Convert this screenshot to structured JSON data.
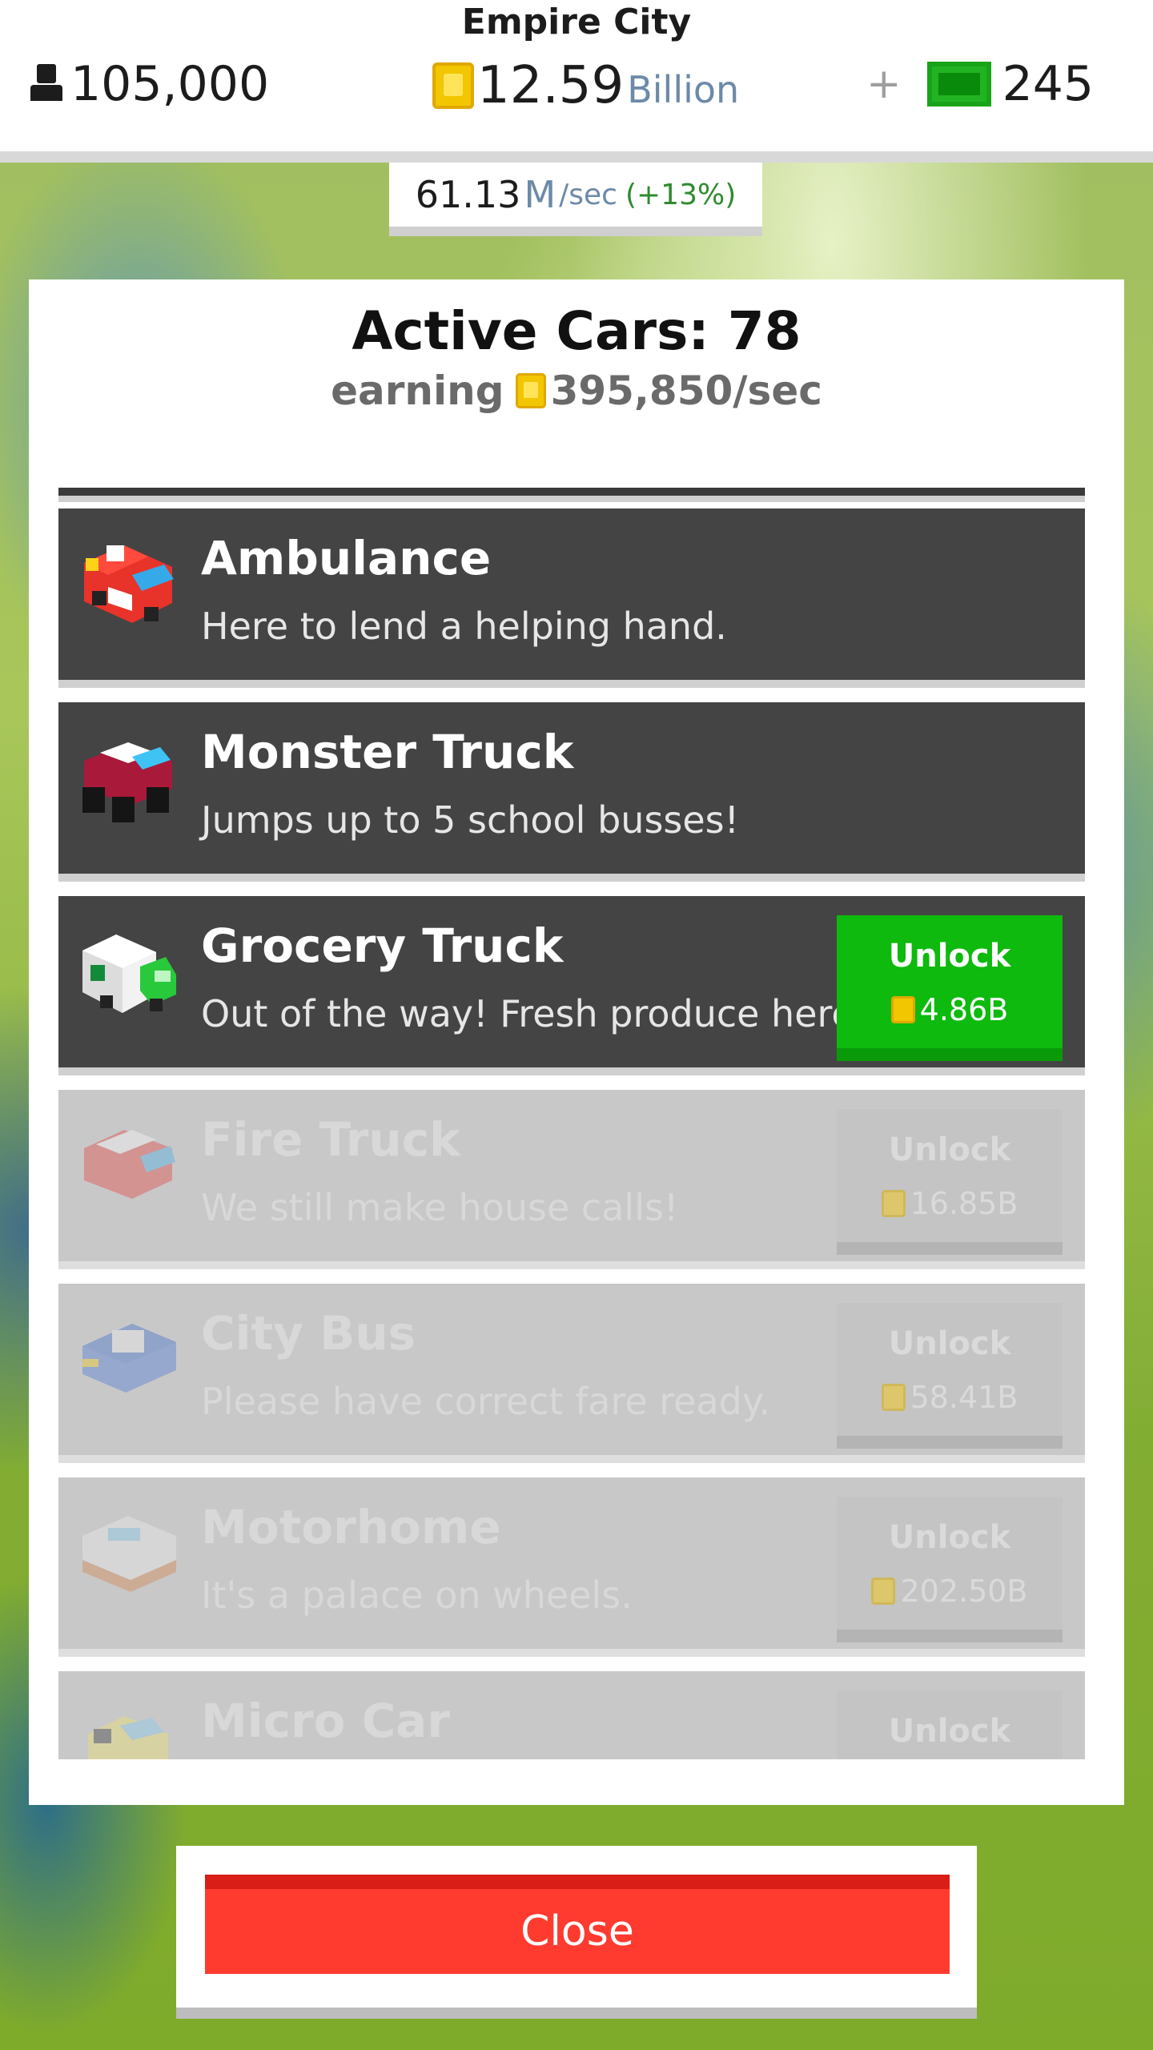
{
  "header": {
    "city_name": "Empire City",
    "population": "105,000",
    "coins_amount": "12.59",
    "coins_unit": "Billion",
    "plus": "+",
    "cash": "245",
    "rate_value": "61.13",
    "rate_unit": "M",
    "rate_per": "/sec",
    "rate_boost": "(+13%)"
  },
  "panel": {
    "title": "Active Cars: 78",
    "earning_label": "earning",
    "earning_value": "395,850/sec"
  },
  "cars": [
    {
      "name": "Ambulance",
      "desc": "Here to lend a helping hand."
    },
    {
      "name": "Monster Truck",
      "desc": "Jumps up to 5 school busses!"
    },
    {
      "name": "Grocery Truck",
      "desc": "Out of the way! Fresh produce here!",
      "unlock": "Unlock",
      "price": "4.86B"
    },
    {
      "name": "Fire Truck",
      "desc": "We still make house calls!",
      "unlock": "Unlock",
      "price": "16.85B"
    },
    {
      "name": "City Bus",
      "desc": "Please have correct fare ready.",
      "unlock": "Unlock",
      "price": "58.41B"
    },
    {
      "name": "Motorhome",
      "desc": "It's a palace on wheels.",
      "unlock": "Unlock",
      "price": "202.50B"
    },
    {
      "name": "Micro Car",
      "desc": "",
      "unlock": "Unlock",
      "price": ""
    }
  ],
  "close_label": "Close",
  "colors": {
    "unlock_green": "#0dba0d",
    "close_red": "#ff3b2f",
    "row_dark": "#444444",
    "row_locked": "#c8c8c8"
  }
}
